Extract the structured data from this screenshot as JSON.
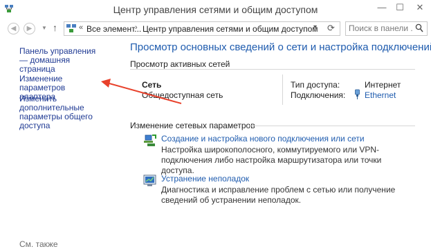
{
  "window": {
    "title": "Центр управления сетями и общим доступом",
    "controls": {
      "minimize": "—",
      "maximize": "☐",
      "close": "✕"
    }
  },
  "address_bar": {
    "chevrons": "«",
    "crumb_1": "Все элемент...",
    "separator": "›",
    "crumb_2": "Центр управления сетями и общим доступом",
    "dropdown": "▾",
    "refresh": "⟳"
  },
  "search": {
    "placeholder": "Поиск в панели ..."
  },
  "left_nav": {
    "home": "Панель управления — домашняя страница",
    "adapter": "Изменение параметров адаптера",
    "sharing": "Изменить дополнительные параметры общего доступа",
    "see_also": "См. также"
  },
  "main": {
    "title": "Просмотр основных сведений о сети и настройка подключений",
    "active_networks_heading": "Просмотр активных сетей",
    "network": {
      "name": "Сеть",
      "type": "Общедоступная сеть",
      "access_label": "Тип доступа:",
      "access_value": "Интернет",
      "connections_label": "Подключения:",
      "connection_value": "Ethernet"
    },
    "change_heading": "Изменение сетевых параметров",
    "tasks": [
      {
        "link": "Создание и настройка нового подключения или сети",
        "desc": "Настройка широкополосного, коммутируемого или VPN-подключения либо настройка маршрутизатора или точки доступа."
      },
      {
        "link": "Устранение неполадок",
        "desc": "Диагностика и исправление проблем с сетью или получение сведений об устранении неполадок."
      }
    ]
  },
  "colors": {
    "link": "#1e5bae",
    "nav_link": "#1f3a93",
    "annotation_arrow": "#e8412b"
  },
  "icons": [
    "network-center-icon",
    "back-icon",
    "forward-icon",
    "up-icon",
    "search-icon",
    "ethernet-icon",
    "new-connection-icon",
    "troubleshoot-icon"
  ]
}
